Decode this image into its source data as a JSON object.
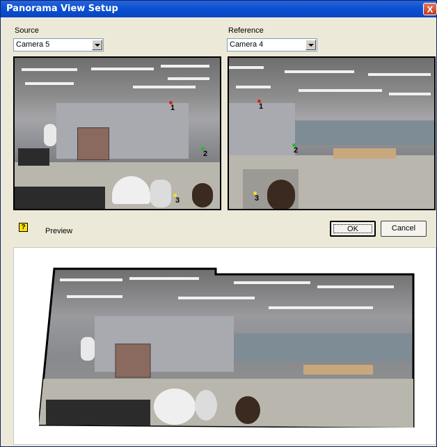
{
  "window": {
    "title": "Panorama View Setup",
    "close_glyph": "X"
  },
  "source": {
    "label": "Source",
    "selected": "Camera 5"
  },
  "reference": {
    "label": "Reference",
    "selected": "Camera 4"
  },
  "markers": {
    "point1": "1",
    "point2": "2",
    "point3": "3"
  },
  "marker_colors": {
    "point1": "#e02020",
    "point2": "#20c020",
    "point3": "#f0e020"
  },
  "preview": {
    "help_glyph": "?",
    "label": "Preview"
  },
  "buttons": {
    "ok": "OK",
    "cancel": "Cancel"
  }
}
